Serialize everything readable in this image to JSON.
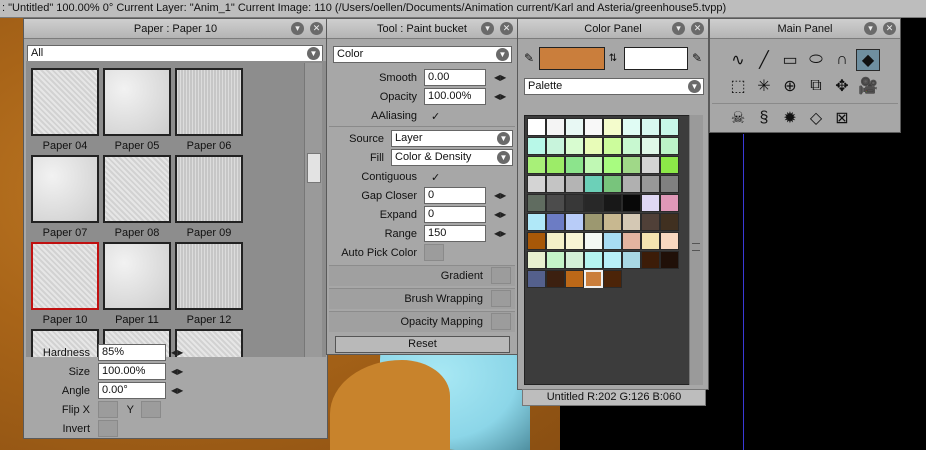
{
  "statusbar": {
    "text": ": \"Untitled\"   100.00%   0°  Current Layer: \"Anim_1\"  Current Image: 110 (/Users/oellen/Documents/Animation current/Karl and Asteria/greenhouse5.tvpp)"
  },
  "paper_panel": {
    "title": "Paper : Paper 10",
    "filter": "All",
    "papers": [
      {
        "name": "Paper 04"
      },
      {
        "name": "Paper 05"
      },
      {
        "name": "Paper 06"
      },
      {
        "name": "Paper 07"
      },
      {
        "name": "Paper 08"
      },
      {
        "name": "Paper 09"
      },
      {
        "name": "Paper 10",
        "selected": true
      },
      {
        "name": "Paper 11"
      },
      {
        "name": "Paper 12"
      }
    ],
    "hardness_label": "Hardness",
    "hardness": "85%",
    "size_label": "Size",
    "size": "100.00%",
    "angle_label": "Angle",
    "angle": "0.00°",
    "flipx_label": "Flip X",
    "y_label": "Y",
    "invert_label": "Invert"
  },
  "tool_panel": {
    "title": "Tool : Paint bucket",
    "mode": "Color",
    "smooth_label": "Smooth",
    "smooth": "0.00",
    "opacity_label": "Opacity",
    "opacity": "100.00%",
    "aaliasing_label": "AAliasing",
    "source_label": "Source",
    "source": "Layer",
    "fill_label": "Fill",
    "fill": "Color & Density",
    "contiguous_label": "Contiguous",
    "gap_closer_label": "Gap Closer",
    "gap_closer": "0",
    "expand_label": "Expand",
    "expand": "0",
    "range_label": "Range",
    "range": "150",
    "auto_pick_label": "Auto Pick Color",
    "gradient_label": "Gradient",
    "brush_wrapping_label": "Brush Wrapping",
    "opacity_mapping_label": "Opacity Mapping",
    "reset_label": "Reset",
    "check_glyph": "✓"
  },
  "color_panel": {
    "title": "Color Panel",
    "primary_color": "#ca7e3c",
    "secondary_color": "#ffffff",
    "palette_label": "Palette",
    "status": "Untitled R:202 G:126 B:060",
    "palette_rows": [
      [
        "#ffffff",
        "#f4f4f4",
        "#e8f8f4",
        "#f8f8f8",
        "#f4fccc",
        "#e0fcf4",
        "#d8f8f0",
        "#c8f8e8"
      ],
      [
        "#b8f8e8",
        "#c8f4dc",
        "#d8fcd0",
        "#e8fcb8",
        "#ccfc9c",
        "#c8f8d0",
        "#e0f8e8",
        "#bcf4c8"
      ],
      [
        "#a8f078",
        "#9cec68",
        "#8ce48c",
        "#c0f8b4",
        "#a8fc80",
        "#a0d888",
        "#d4d4d4",
        "#8ce848"
      ],
      [
        "#d4d4d4",
        "#c4c4c4",
        "#b4b4b4",
        "#6cd0b8",
        "#78c47c",
        "#b0b0b0",
        "#989898",
        "#808080"
      ],
      [
        "#606c60",
        "#4c4c4c",
        "#383838",
        "#282828",
        "#181818",
        "#080808",
        "#e0d8f4",
        "#e098b8"
      ],
      [
        "#b0e8f8",
        "#6c7cc4",
        "#b8ccf8",
        "#9c9870",
        "#c8b890",
        "#d4c8b4",
        "#504038",
        "#403020"
      ],
      [
        "#a85808",
        "#f4f0c8",
        "#f8f4d4",
        "#f4f8f4",
        "#a8dcf4",
        "#e4b4a0",
        "#f4e4b0",
        "#f8d8c0"
      ],
      [
        "#e8f0d0",
        "#c4f4c8",
        "#d4f0d8",
        "#b4f4f0",
        "#b8f0f8",
        "#a8d8e4",
        "#3c1c08",
        "#201008"
      ],
      [
        "#54608c",
        "#3c2010",
        "#bc6818",
        "#ca7e3c",
        "#4c2408"
      ]
    ],
    "selected_cell": [
      8,
      3
    ]
  },
  "main_panel": {
    "title": "Main Panel",
    "tools_row1": [
      {
        "name": "freehand-line-icon",
        "glyph": "∿"
      },
      {
        "name": "line-icon",
        "glyph": "╱"
      },
      {
        "name": "rectangle-icon",
        "glyph": "▭"
      },
      {
        "name": "ellipse-icon",
        "glyph": "⬭"
      },
      {
        "name": "spline-icon",
        "glyph": "∩"
      },
      {
        "name": "paint-bucket-icon",
        "glyph": "◆",
        "active": true
      }
    ],
    "tools_row2": [
      {
        "name": "selection-icon",
        "glyph": "⬚"
      },
      {
        "name": "magic-wand-icon",
        "glyph": "✳"
      },
      {
        "name": "pan-icon",
        "glyph": "⊕"
      },
      {
        "name": "crop-icon",
        "glyph": "⧉"
      },
      {
        "name": "transform-icon",
        "glyph": "✥"
      },
      {
        "name": "camera-icon",
        "glyph": "🎥"
      }
    ],
    "tools_row3": [
      {
        "name": "skull-icon",
        "glyph": "☠"
      },
      {
        "name": "warp-icon",
        "glyph": "§"
      },
      {
        "name": "smudge-icon",
        "glyph": "✹"
      },
      {
        "name": "rotate-canvas-icon",
        "glyph": "◇"
      },
      {
        "name": "clear-icon",
        "glyph": "⊠"
      }
    ]
  }
}
